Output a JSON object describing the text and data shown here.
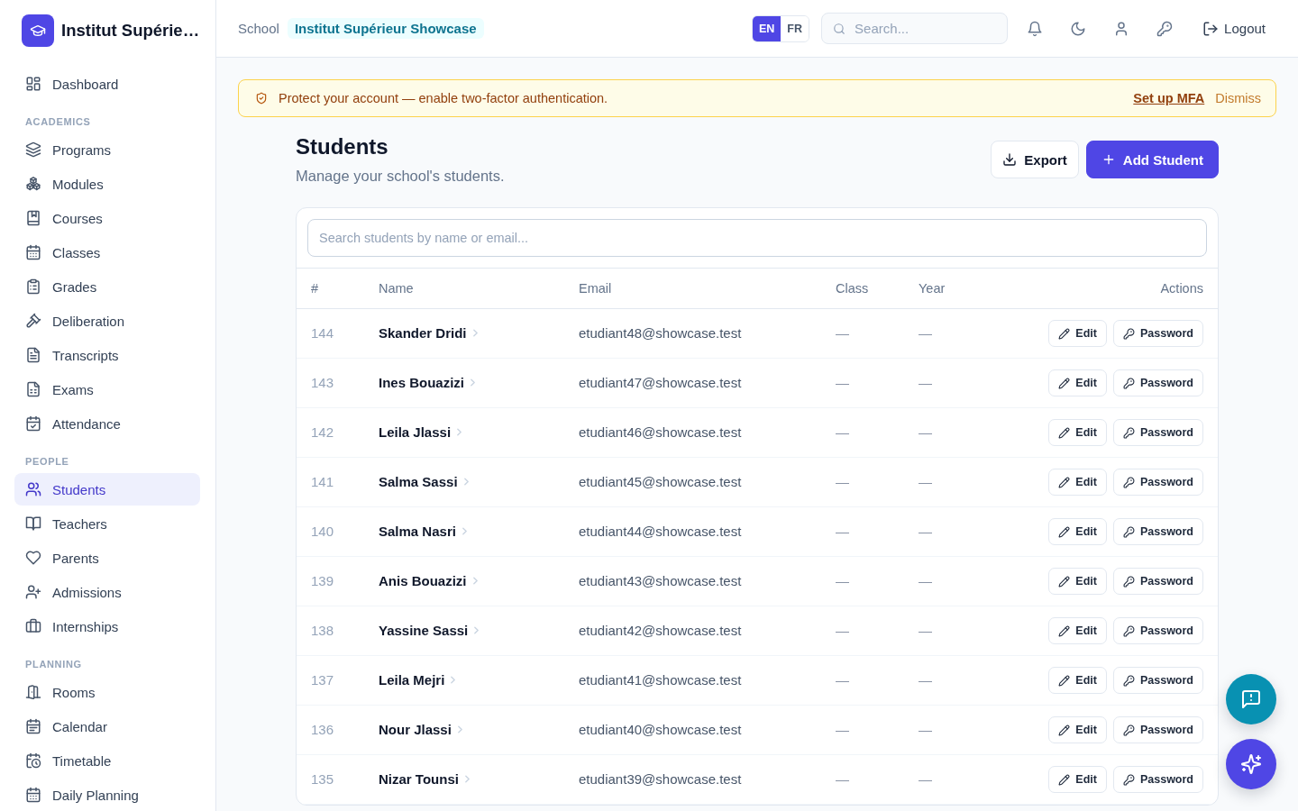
{
  "sidebar": {
    "brand": "Institut Supérie…",
    "sections": [
      {
        "items": [
          {
            "label": "Dashboard",
            "selected": false
          }
        ]
      },
      {
        "heading": "ACADEMICS",
        "items": [
          {
            "label": "Programs",
            "selected": false
          },
          {
            "label": "Modules",
            "selected": false
          },
          {
            "label": "Courses",
            "selected": false
          },
          {
            "label": "Classes",
            "selected": false
          },
          {
            "label": "Grades",
            "selected": false
          },
          {
            "label": "Deliberation",
            "selected": false
          },
          {
            "label": "Transcripts",
            "selected": false
          },
          {
            "label": "Exams",
            "selected": false
          },
          {
            "label": "Attendance",
            "selected": false
          }
        ]
      },
      {
        "heading": "PEOPLE",
        "items": [
          {
            "label": "Students",
            "selected": true
          },
          {
            "label": "Teachers",
            "selected": false
          },
          {
            "label": "Parents",
            "selected": false
          },
          {
            "label": "Admissions",
            "selected": false
          },
          {
            "label": "Internships",
            "selected": false
          }
        ]
      },
      {
        "heading": "PLANNING",
        "items": [
          {
            "label": "Rooms",
            "selected": false
          },
          {
            "label": "Calendar",
            "selected": false
          },
          {
            "label": "Timetable",
            "selected": false
          },
          {
            "label": "Daily Planning",
            "selected": false
          }
        ]
      }
    ]
  },
  "topbar": {
    "context_label": "School",
    "school_name": "Institut Supérieur Showcase",
    "languages": [
      {
        "label": "EN",
        "selected": true
      },
      {
        "label": "FR",
        "selected": false
      }
    ],
    "search": {
      "placeholder": "Search..."
    },
    "logout": "Logout"
  },
  "alert": {
    "message": "Protect your account — enable two-factor authentication.",
    "action": "Set up MFA",
    "dismiss": "Dismiss"
  },
  "page": {
    "title": "Students",
    "subtitle": "Manage your school's students.",
    "buttons": [
      {
        "label": "Export",
        "kind": "export"
      },
      {
        "label": "Add Student",
        "kind": "add"
      }
    ]
  },
  "table": {
    "search": {
      "placeholder": "Search students by name or email..."
    },
    "columns": [
      "#",
      "Name",
      "Email",
      "Class",
      "Year",
      "Actions"
    ],
    "rows": [
      {
        "number": "144",
        "name": "Skander Dridi",
        "email": "etudiant48@showcase.test",
        "class": "—",
        "year": "—",
        "actions": [
          {
            "label": "Edit",
            "kind": "edit"
          },
          {
            "label": "Password",
            "kind": "password"
          }
        ]
      },
      {
        "number": "143",
        "name": "Ines Bouazizi",
        "email": "etudiant47@showcase.test",
        "class": "—",
        "year": "—",
        "actions": [
          {
            "label": "Edit",
            "kind": "edit"
          },
          {
            "label": "Password",
            "kind": "password"
          }
        ]
      },
      {
        "number": "142",
        "name": "Leila Jlassi",
        "email": "etudiant46@showcase.test",
        "class": "—",
        "year": "—",
        "actions": [
          {
            "label": "Edit",
            "kind": "edit"
          },
          {
            "label": "Password",
            "kind": "password"
          }
        ]
      },
      {
        "number": "141",
        "name": "Salma Sassi",
        "email": "etudiant45@showcase.test",
        "class": "—",
        "year": "—",
        "actions": [
          {
            "label": "Edit",
            "kind": "edit"
          },
          {
            "label": "Password",
            "kind": "password"
          }
        ]
      },
      {
        "number": "140",
        "name": "Salma Nasri",
        "email": "etudiant44@showcase.test",
        "class": "—",
        "year": "—",
        "actions": [
          {
            "label": "Edit",
            "kind": "edit"
          },
          {
            "label": "Password",
            "kind": "password"
          }
        ]
      },
      {
        "number": "139",
        "name": "Anis Bouazizi",
        "email": "etudiant43@showcase.test",
        "class": "—",
        "year": "—",
        "actions": [
          {
            "label": "Edit",
            "kind": "edit"
          },
          {
            "label": "Password",
            "kind": "password"
          }
        ]
      },
      {
        "number": "138",
        "name": "Yassine Sassi",
        "email": "etudiant42@showcase.test",
        "class": "—",
        "year": "—",
        "actions": [
          {
            "label": "Edit",
            "kind": "edit"
          },
          {
            "label": "Password",
            "kind": "password"
          }
        ]
      },
      {
        "number": "137",
        "name": "Leila Mejri",
        "email": "etudiant41@showcase.test",
        "class": "—",
        "year": "—",
        "actions": [
          {
            "label": "Edit",
            "kind": "edit"
          },
          {
            "label": "Password",
            "kind": "password"
          }
        ]
      },
      {
        "number": "136",
        "name": "Nour Jlassi",
        "email": "etudiant40@showcase.test",
        "class": "—",
        "year": "—",
        "actions": [
          {
            "label": "Edit",
            "kind": "edit"
          },
          {
            "label": "Password",
            "kind": "password"
          }
        ]
      },
      {
        "number": "135",
        "name": "Nizar Tounsi",
        "email": "etudiant39@showcase.test",
        "class": "—",
        "year": "—",
        "actions": [
          {
            "label": "Edit",
            "kind": "edit"
          },
          {
            "label": "Password",
            "kind": "password"
          }
        ]
      }
    ]
  }
}
